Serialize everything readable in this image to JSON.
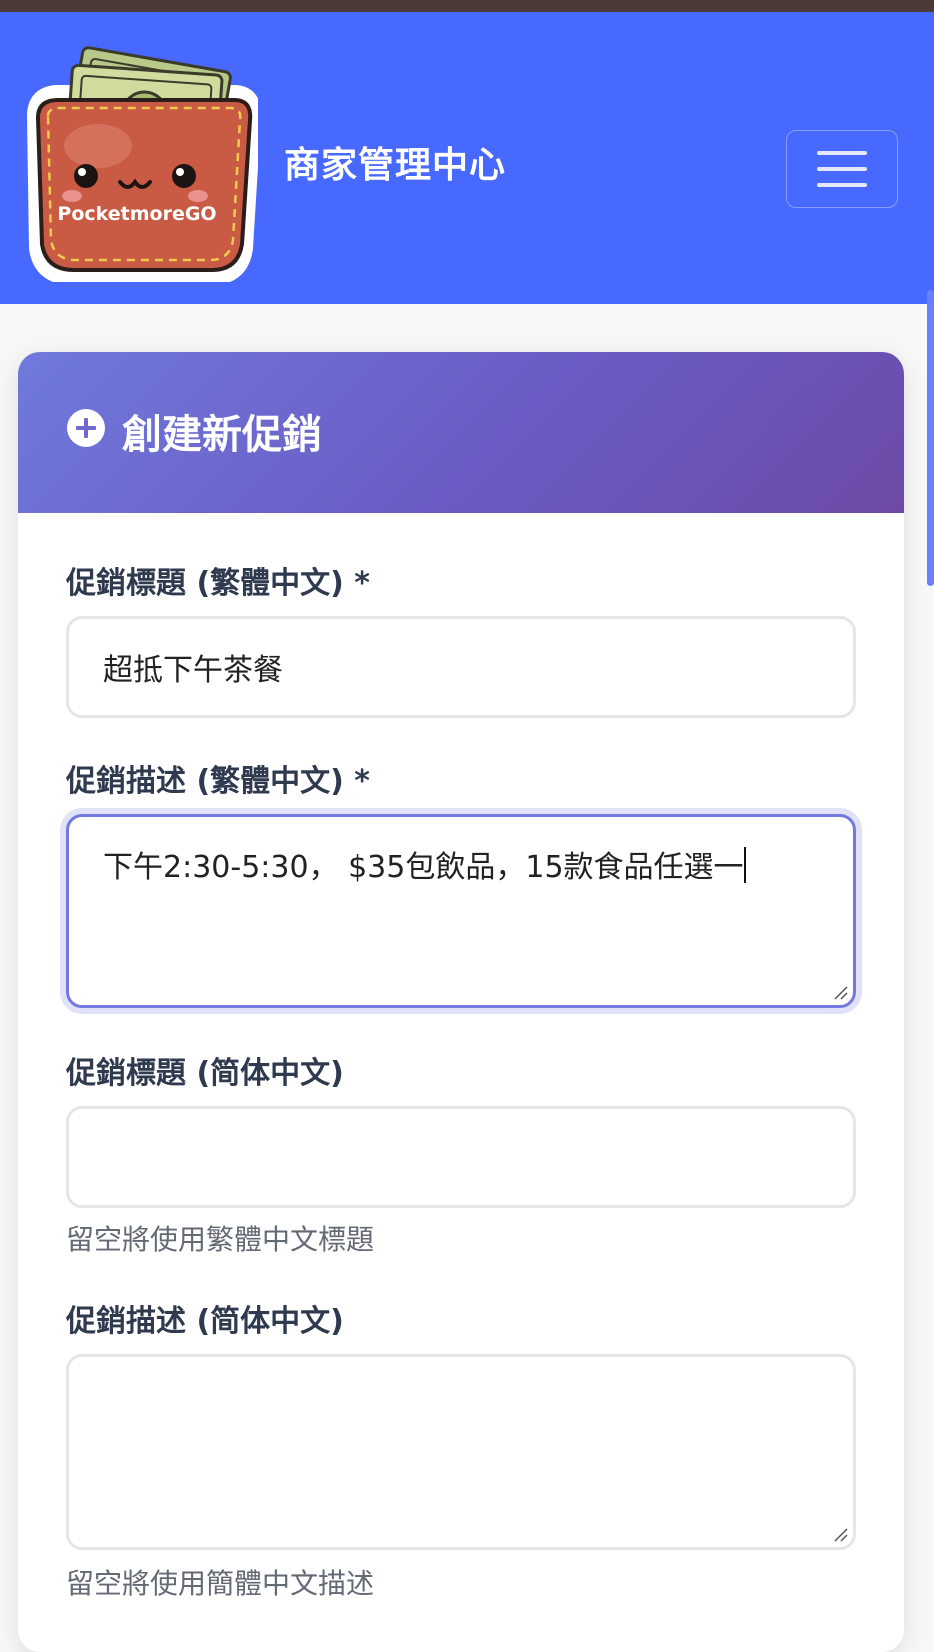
{
  "app": {
    "brand_text": "PocketmoreGO",
    "title": "商家管理中心"
  },
  "navbar": {
    "menu_icon": "hamburger-menu-icon"
  },
  "card": {
    "icon": "plus-circle-icon",
    "title": "創建新促銷"
  },
  "form": {
    "title_tc": {
      "label": "促銷標題 (繁體中文) *",
      "value": "超抵下午茶餐"
    },
    "desc_tc": {
      "label": "促銷描述 (繁體中文) *",
      "value": "下午2:30-5:30，  $35包飲品，15款食品任選一"
    },
    "title_sc": {
      "label": "促銷標題 (简体中文)",
      "value": "",
      "help": "留空將使用繁體中文標題"
    },
    "desc_sc": {
      "label": "促銷描述 (简体中文)",
      "value": "",
      "help": "留空將使用簡體中文描述"
    }
  },
  "colors": {
    "navbar": "#4869ff",
    "card_header_start": "#7079dc",
    "card_header_end": "#6d4aa6",
    "focus_border": "#7479e0"
  }
}
